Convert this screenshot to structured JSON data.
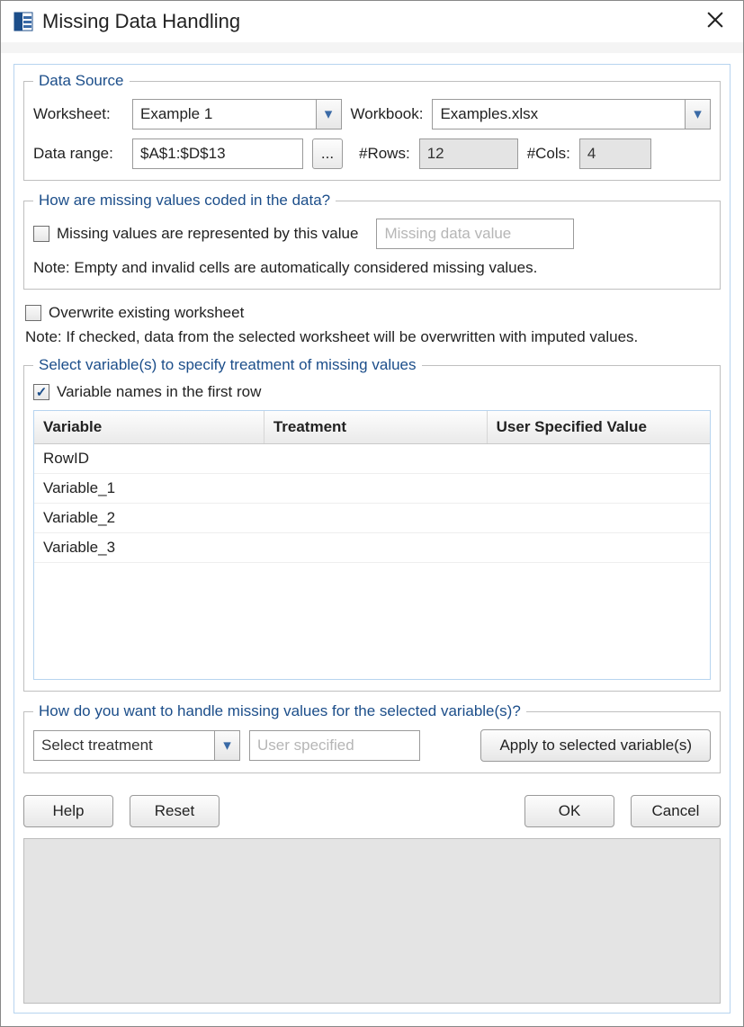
{
  "window": {
    "title": "Missing Data Handling"
  },
  "data_source": {
    "legend": "Data Source",
    "worksheet_label": "Worksheet:",
    "worksheet_value": "Example 1",
    "workbook_label": "Workbook:",
    "workbook_value": "Examples.xlsx",
    "data_range_label": "Data range:",
    "data_range_value": "$A$1:$D$13",
    "browse_btn": "...",
    "rows_label": "#Rows:",
    "rows_value": "12",
    "cols_label": "#Cols:",
    "cols_value": "4"
  },
  "coding": {
    "legend": "How are missing values coded in the data?",
    "chk_label": "Missing values are represented by this value",
    "value_placeholder": "Missing data value",
    "note": "Note: Empty and invalid cells are automatically considered missing values."
  },
  "overwrite": {
    "chk_label": "Overwrite existing worksheet",
    "note": "Note: If checked, data from the selected worksheet will be overwritten with imputed values."
  },
  "variables": {
    "legend": "Select variable(s) to specify treatment of missing values",
    "first_row_label": "Variable names in the first row",
    "columns": {
      "variable": "Variable",
      "treatment": "Treatment",
      "user_value": "User Specified Value"
    },
    "rows": [
      {
        "variable": "RowID",
        "treatment": "",
        "user_value": ""
      },
      {
        "variable": "Variable_1",
        "treatment": "",
        "user_value": ""
      },
      {
        "variable": "Variable_2",
        "treatment": "",
        "user_value": ""
      },
      {
        "variable": "Variable_3",
        "treatment": "",
        "user_value": ""
      }
    ]
  },
  "handle": {
    "legend": "How do you want to handle missing values for the selected variable(s)?",
    "treatment_placeholder": "Select treatment",
    "user_placeholder": "User specified",
    "apply_btn": "Apply to selected variable(s)"
  },
  "buttons": {
    "help": "Help",
    "reset": "Reset",
    "ok": "OK",
    "cancel": "Cancel"
  }
}
